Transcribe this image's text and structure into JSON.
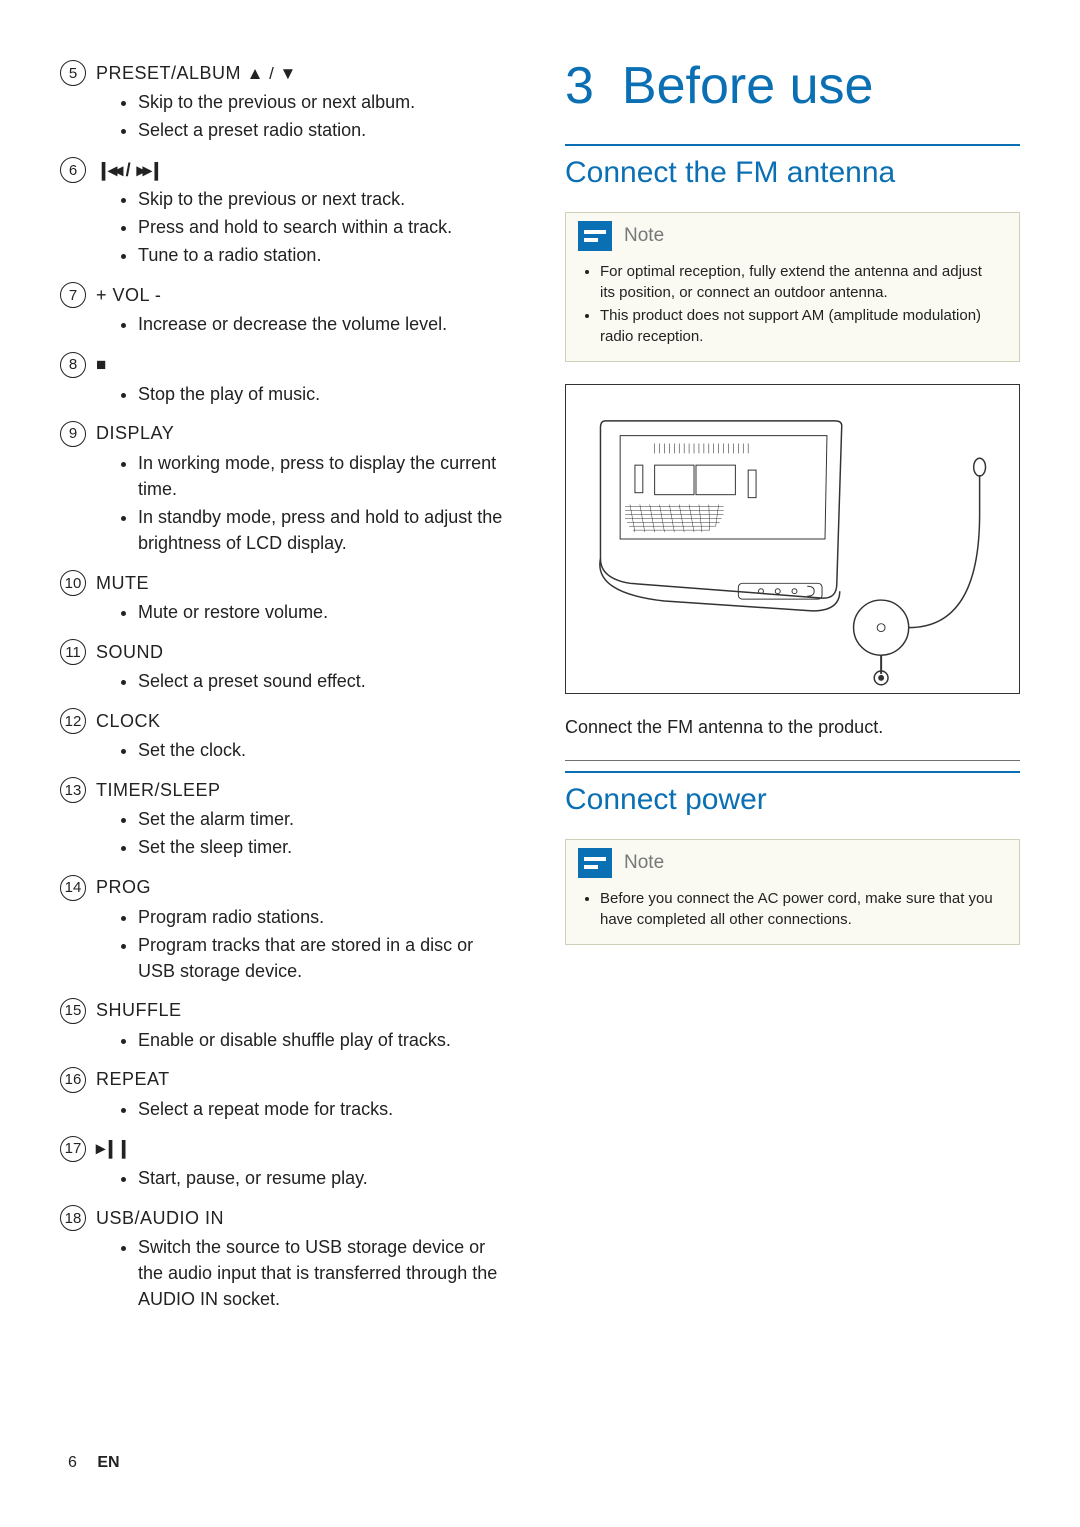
{
  "leftColumn": {
    "items": [
      {
        "num": "5",
        "title": "PRESET/ALBUM",
        "symbols": "▲ / ▼",
        "desc": [
          "Skip to the previous or next album.",
          "Select a preset radio station."
        ]
      },
      {
        "num": "6",
        "title": "",
        "symbols": "◂◂ / ▸▸",
        "symbolPrefix": "❙",
        "symbolSuffix": "❙",
        "desc": [
          "Skip to the previous or next track.",
          "Press and hold to search within a track.",
          "Tune to a radio station."
        ]
      },
      {
        "num": "7",
        "title": "+ VOL -",
        "desc": [
          "Increase or decrease the volume level."
        ]
      },
      {
        "num": "8",
        "title": "",
        "symbols": "■",
        "desc": [
          "Stop the play of music."
        ]
      },
      {
        "num": "9",
        "title": "DISPLAY",
        "desc": [
          "In working mode, press to display the current time.",
          "In standby mode, press and hold to adjust the brightness of LCD display."
        ]
      },
      {
        "num": "10",
        "title": "MUTE",
        "desc": [
          "Mute or restore volume."
        ]
      },
      {
        "num": "11",
        "title": "SOUND",
        "desc": [
          "Select a preset sound effect."
        ]
      },
      {
        "num": "12",
        "title": "CLOCK",
        "desc": [
          "Set the clock."
        ]
      },
      {
        "num": "13",
        "title": "TIMER/SLEEP",
        "desc": [
          "Set the alarm timer.",
          "Set the sleep timer."
        ]
      },
      {
        "num": "14",
        "title": "PROG",
        "desc": [
          "Program radio stations.",
          "Program tracks that are stored in a disc or USB storage device."
        ]
      },
      {
        "num": "15",
        "title": "SHUFFLE",
        "desc": [
          "Enable or disable shuffle play of tracks."
        ]
      },
      {
        "num": "16",
        "title": "REPEAT",
        "desc": [
          "Select a repeat mode for tracks."
        ]
      },
      {
        "num": "17",
        "title": "",
        "symbols": "▸❙❙",
        "desc": [
          "Start, pause, or resume play."
        ]
      },
      {
        "num": "18",
        "title": "USB/AUDIO IN",
        "desc": [
          "Switch the source to USB storage device or the audio input that is transferred through the AUDIO IN socket."
        ]
      }
    ]
  },
  "rightColumn": {
    "chapterNum": "3",
    "chapterTitle": "Before use",
    "section1": {
      "title": "Connect the FM antenna",
      "note": {
        "label": "Note",
        "bullets": [
          "For optimal reception, fully extend the antenna and adjust its position, or connect an outdoor antenna.",
          "This product does not support AM (amplitude modulation) radio reception."
        ]
      },
      "bodyText": "Connect the FM antenna to the product."
    },
    "section2": {
      "title": "Connect power",
      "note": {
        "label": "Note",
        "bullets": [
          "Before you connect the AC power cord, make sure that you have completed all other connections."
        ]
      }
    }
  },
  "footer": {
    "pageNum": "6",
    "lang": "EN"
  }
}
